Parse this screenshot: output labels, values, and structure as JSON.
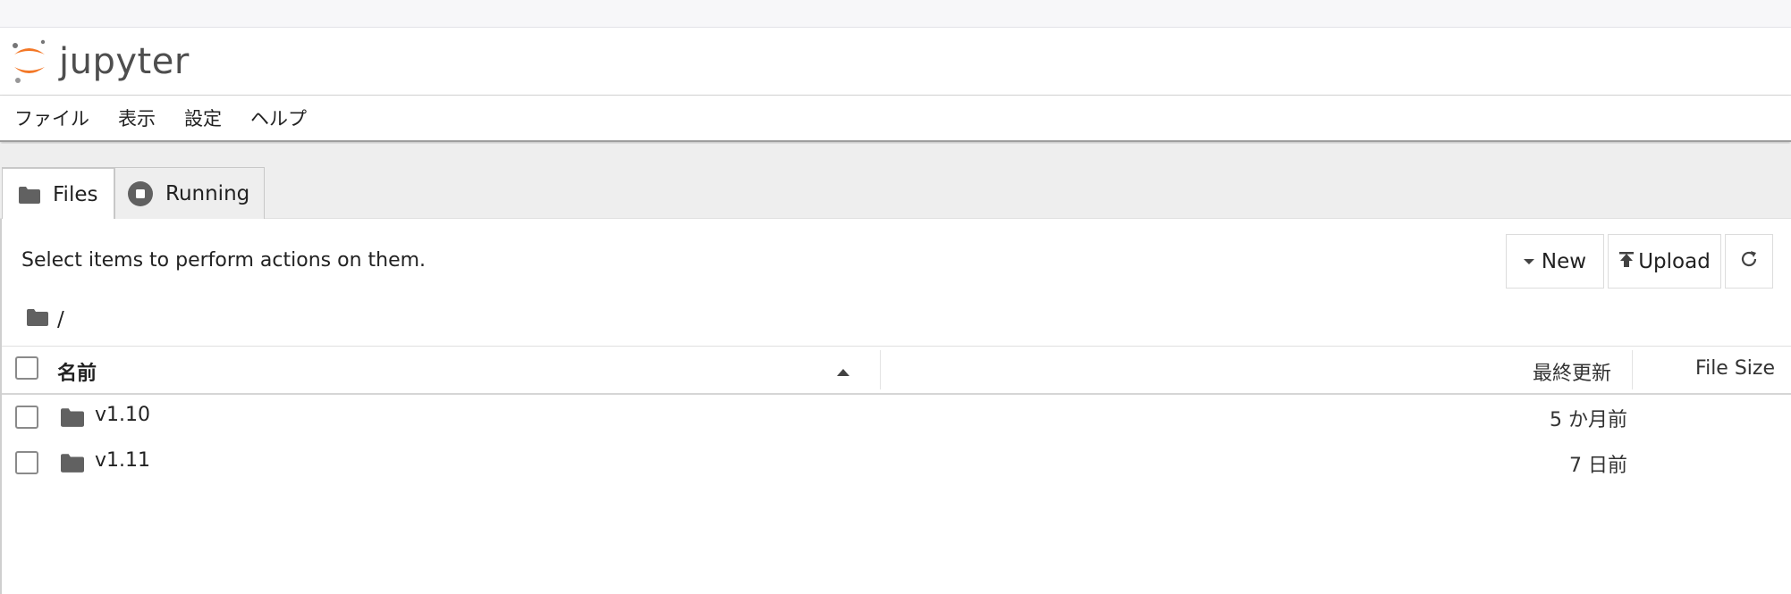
{
  "header": {
    "logo_text": "jupyter",
    "brand_color": "#F37726"
  },
  "menu": [
    {
      "label": "ファイル"
    },
    {
      "label": "表示"
    },
    {
      "label": "設定"
    },
    {
      "label": "ヘルプ"
    }
  ],
  "tabs": {
    "files": {
      "label": "Files",
      "icon": "folder-icon",
      "active": true
    },
    "running": {
      "label": "Running",
      "icon": "stop-circle-icon",
      "active": false
    }
  },
  "main": {
    "hint": "Select items to perform actions on them.",
    "toolbar": {
      "new_label": "New",
      "upload_label": "Upload",
      "refresh_icon": "refresh-icon"
    },
    "breadcrumb": {
      "path": "/"
    }
  },
  "table": {
    "columns": {
      "name": "名前",
      "modified": "最終更新",
      "size": "File Size"
    },
    "sort": "ascending",
    "rows": [
      {
        "name": "v1.10",
        "modified": "5 か月前",
        "size": "",
        "type": "folder"
      },
      {
        "name": "v1.11",
        "modified": "7 日前",
        "size": "",
        "type": "folder"
      }
    ]
  }
}
